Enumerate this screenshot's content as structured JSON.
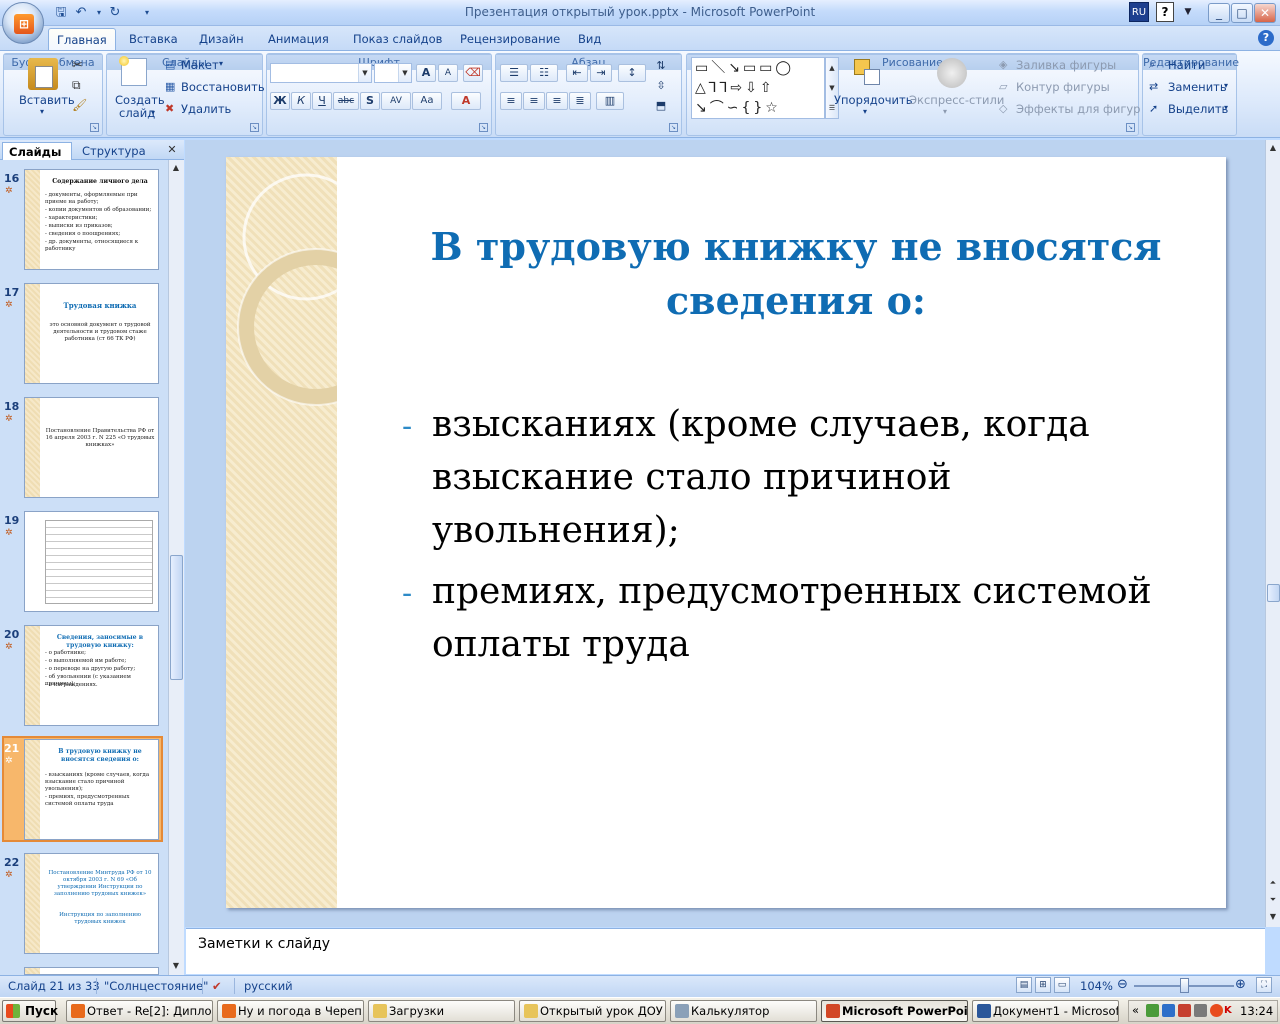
{
  "window": {
    "title": "Презентация открытый урок.pptx - Microsoft PowerPoint",
    "lang": "RU",
    "help": "?",
    "minimize": "_",
    "maximize": "□",
    "close": "✕"
  },
  "tabs": [
    "Главная",
    "Вставка",
    "Дизайн",
    "Анимация",
    "Показ слайдов",
    "Рецензирование",
    "Вид"
  ],
  "ribbon": {
    "clipboard": {
      "label": "Буфер обмена",
      "paste": "Вставить"
    },
    "slides": {
      "label": "Слайды",
      "create": "Создать",
      "create2": "слайд",
      "layout": "Макет",
      "reset": "Восстановить",
      "delete": "Удалить"
    },
    "font": {
      "label": "Шрифт",
      "bold": "Ж",
      "italic": "К",
      "underline": "Ч",
      "strike": "abc",
      "shadow": "S",
      "spacing": "AV",
      "case": "Aa",
      "grow": "A",
      "shrink": "A",
      "color": "A"
    },
    "paragraph": {
      "label": "Абзац"
    },
    "drawing": {
      "label": "Рисование",
      "arrange": "Упорядочить",
      "quick_styles": "Экспресс-стили",
      "fill": "Заливка фигуры",
      "outline": "Контур фигуры",
      "effects": "Эффекты для фигур"
    },
    "editing": {
      "label": "Редактирование",
      "find": "Найти",
      "replace": "Заменить",
      "select": "Выделить"
    }
  },
  "left_pane": {
    "tab_slides": "Слайды",
    "tab_outline": "Структура",
    "close": "✕",
    "thumbnails": [
      {
        "num": "16",
        "title": "Содержание личного дела",
        "lines": [
          "- документы, оформляемые при приеме на работу;",
          "- копии документов об образовании;",
          "- характеристики;",
          "- выписки из приказов;",
          "- сведения о поощрениях;",
          "- др. документы, относящиеся к работнику"
        ]
      },
      {
        "num": "17",
        "title": "Трудовая книжка",
        "lines": [
          "это основной документ о трудовой деятельности и трудовом стаже работника (ст 66 ТК РФ)"
        ]
      },
      {
        "num": "18",
        "title": "",
        "lines": [
          "Постановление Правительства РФ от 16 апреля 2003 г. N 225 «О трудовых книжках»"
        ]
      },
      {
        "num": "19",
        "title": "",
        "lines": []
      },
      {
        "num": "20",
        "title": "Сведения, заносимые в трудовую книжку:",
        "lines": [
          "- о работнике;",
          "- о выполняемой им работе;",
          "- о переводе на другую работу;",
          "- об увольнении (с указанием причины);",
          "- о награждениях."
        ]
      },
      {
        "num": "21",
        "title": "В трудовую книжку не вносятся сведения о:",
        "lines": [
          "- взысканиях (кроме случаев, когда взыскание стало причиной увольнения);",
          "- премиях, предусмотренных системой оплаты труда"
        ]
      },
      {
        "num": "22",
        "title": "Постановление Минтруда РФ от 10 октября 2003 г. N 69 «Об утверждении Инструкции по заполнению трудовых книжек»",
        "lines": [
          "Инструкция по заполнению трудовых книжек"
        ]
      }
    ]
  },
  "slide": {
    "title": "В трудовую книжку не вносятся сведения о:",
    "bullets": [
      "взысканиях (кроме случаев, когда взыскание стало причиной увольнения);",
      "премиях, предусмотренных системой оплаты труда"
    ],
    "bullet_marker": "-"
  },
  "notes": {
    "placeholder": "Заметки к слайду"
  },
  "status": {
    "slide_info": "Слайд 21 из 33",
    "theme": "\"Солнцестояние\"",
    "language": "русский",
    "zoom": "104%"
  },
  "taskbar": {
    "start": "Пуск",
    "items": [
      {
        "label": "Ответ - Re[2]: Дипло...",
        "color": "#e86a1c"
      },
      {
        "label": "Ну и погода в Череп...",
        "color": "#e86a1c"
      },
      {
        "label": "Загрузки",
        "color": "#e7c45a"
      },
      {
        "label": "Открытый урок ДОУ",
        "color": "#e7c45a"
      },
      {
        "label": "Калькулятор",
        "color": "#8aa0b8"
      },
      {
        "label": "Microsoft PowerPoi...",
        "color": "#d24726"
      },
      {
        "label": "Документ1 - Microsof...",
        "color": "#2b579a"
      }
    ],
    "clock": "13:24",
    "tray_lang": "«"
  }
}
